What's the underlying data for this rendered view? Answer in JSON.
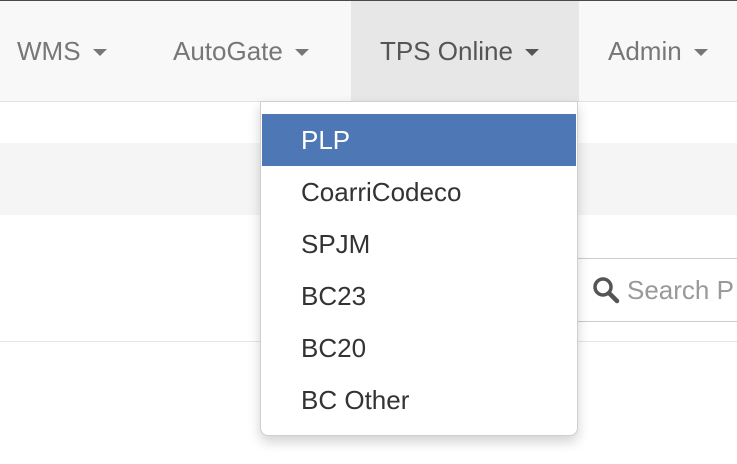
{
  "navbar": {
    "items": [
      {
        "label": "WMS"
      },
      {
        "label": "AutoGate"
      },
      {
        "label": "TPS Online",
        "open": true
      },
      {
        "label": "Admin"
      }
    ]
  },
  "dropdown": {
    "items": [
      {
        "label": "PLP",
        "active": true
      },
      {
        "label": "CoarriCodeco"
      },
      {
        "label": "SPJM"
      },
      {
        "label": "BC23"
      },
      {
        "label": "BC20"
      },
      {
        "label": "BC Other"
      }
    ]
  },
  "search": {
    "placeholder": "Search P",
    "icon": "search-icon"
  },
  "colors": {
    "active_item_bg": "#4d78b5",
    "navbar_bg": "#f8f8f8",
    "open_nav_bg": "#e7e7e7"
  }
}
